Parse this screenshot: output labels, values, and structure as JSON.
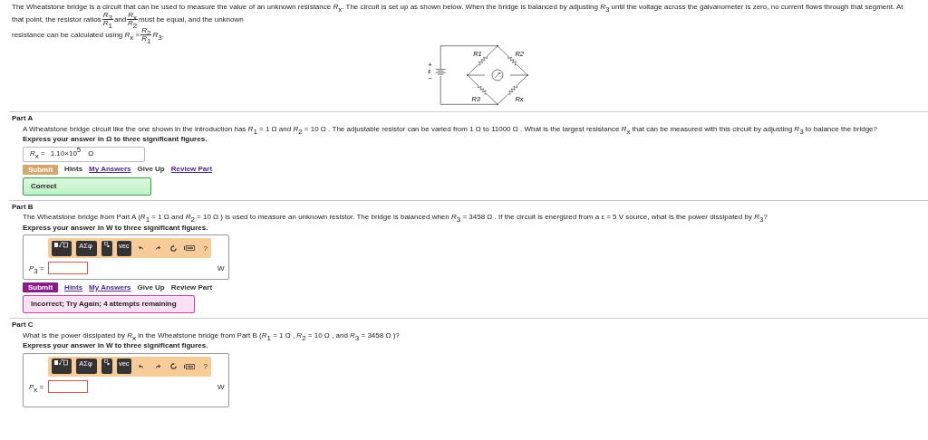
{
  "intro": {
    "lines": [
      [
        {
          "kind": "text",
          "text": "The Wheatstone bridge is a circuit that can be used to measure the value of an unknown resistance *R*$_{x}$. The circuit is set up as shown below. When the bridge is balanced by adjusting *R*$_{3}$ until the voltage across the galvanometer is zero, no current flows through that segment. At that point, the resistor ratios"
        },
        {
          "kind": "fraction",
          "num": "*R*$_{3}$",
          "den": "*R*$_{1}$"
        },
        {
          "kind": "text",
          "text": "and"
        },
        {
          "kind": "fraction",
          "num": "*R*$_{x}$",
          "den": "*R*$_{2}$"
        },
        {
          "kind": "text",
          "text": "must be equal, and the unknown"
        }
      ],
      [
        {
          "kind": "text",
          "text": "resistance can be calculated using *R*$_{x}$ ="
        },
        {
          "kind": "fraction",
          "num": "*R*$_{2}$",
          "den": "*R*$_{1}$"
        },
        {
          "kind": "text",
          "text": "*R*$_{3}$."
        }
      ]
    ]
  },
  "circuit": {
    "labels": [
      "R1",
      "R2",
      "R3",
      "Rx"
    ],
    "source": {
      "plus": "+",
      "emf": "ε",
      "minus": "−"
    }
  },
  "parts": [
    {
      "title": "Part A",
      "question": "A Wheatstone bridge circuit like the one shown in the introduction has *R*$_{1}$ = 1 Ω and *R*$_{2}$ = 10 Ω . The adjustable resistor can be varied from 1 Ω to 11000 Ω . What is the largest resistance *R*$_{x}$ that can be measured with this circuit by adjusting *R*$_{3}$ to balance the bridge?",
      "instruction": "Express your answer in Ω to three significant figures.",
      "answer": {
        "kind": "submitted",
        "label": "*R*$_{x}$ =",
        "value": "1.10×10$^{5}$",
        "unit": "Ω"
      },
      "submit": {
        "label": "Submit",
        "disabled": true
      },
      "links": [
        {
          "label": "Hints",
          "link": false
        },
        {
          "label": "My Answers",
          "link": true
        },
        {
          "label": "Give Up",
          "link": false
        },
        {
          "label": "Review Part",
          "link": true
        }
      ],
      "feedback": {
        "kind": "correct",
        "text": "Correct"
      }
    },
    {
      "title": "Part B",
      "question": "The Wheatstone bridge from Part A (*R*$_{1}$ = 1 Ω and *R*$_{2}$ = 10 Ω ) is used to measure an unknown resistor. The bridge is balanced when *R*$_{3}$ = 3458 Ω . If the circuit is energized from a ε = 5 V source, what is the power dissipated by *R*$_{3}$?",
      "instruction": "Express your answer in W to three significant figures.",
      "answer": {
        "kind": "editor",
        "label": "*P*$_{3}$ =",
        "unit": "W",
        "toolbar": [
          {
            "kind": "templates"
          },
          {
            "kind": "symbols",
            "label": "ΑΣφ"
          },
          {
            "kind": "subscript"
          },
          {
            "kind": "vector",
            "label": "vec"
          },
          {
            "kind": "undo"
          },
          {
            "kind": "redo"
          },
          {
            "kind": "reset"
          },
          {
            "kind": "keyboard"
          },
          {
            "kind": "help",
            "label": "?"
          }
        ]
      },
      "submit": {
        "label": "Submit",
        "disabled": false
      },
      "links": [
        {
          "label": "Hints",
          "link": true
        },
        {
          "label": "My Answers",
          "link": true
        },
        {
          "label": "Give Up",
          "link": false
        },
        {
          "label": "Review Part",
          "link": false
        }
      ],
      "feedback": {
        "kind": "incorrect",
        "text": "Incorrect; Try Again; 4 attempts remaining"
      }
    },
    {
      "title": "Part C",
      "question": "What is the power dissipated by *R*$_{x}$ in the Wheatstone bridge from Part B (*R*$_{1}$ = 1 Ω , *R*$_{2}$ = 10 Ω , and *R*$_{3}$ = 3458 Ω )?",
      "instruction": "Express your answer in W to three significant figures.",
      "answer": {
        "kind": "editor",
        "label": "*P*$_{x}$ =",
        "unit": "W",
        "toolbar": [
          {
            "kind": "templates"
          },
          {
            "kind": "symbols",
            "label": "ΑΣφ"
          },
          {
            "kind": "subscript"
          },
          {
            "kind": "vector",
            "label": "vec"
          },
          {
            "kind": "undo"
          },
          {
            "kind": "redo"
          },
          {
            "kind": "reset"
          },
          {
            "kind": "keyboard"
          },
          {
            "kind": "help",
            "label": "?"
          }
        ]
      }
    }
  ]
}
